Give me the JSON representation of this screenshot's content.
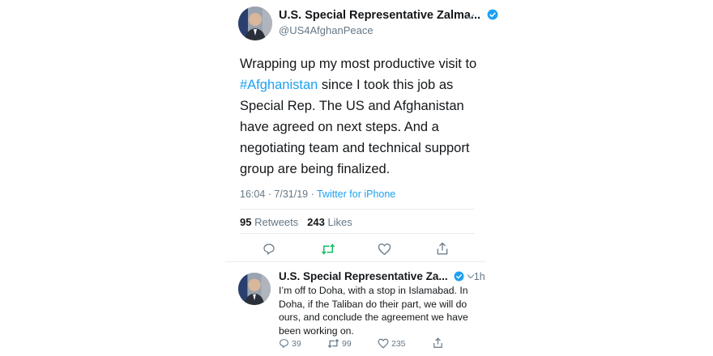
{
  "main_tweet": {
    "author_name": "U.S. Special Representative Zalma...",
    "handle": "@US4AfghanPeace",
    "text_before_hashtag": "Wrapping up my most productive visit to ",
    "hashtag": "#Afghanistan",
    "text_after_hashtag": " since I took this job as Special Rep. The US and Afghanistan have agreed on next steps. And a negotiating team and technical support group are being finalized.",
    "time": "16:04 · 7/31/19 · ",
    "source": "Twitter for iPhone",
    "retweet_count": "95",
    "retweet_label": " Retweets",
    "like_count": "243",
    "like_label": " Likes"
  },
  "reply_tweet": {
    "author_name": "U.S. Special Representative Za...",
    "time_ago": "· 1h",
    "text": "I’m off to Doha, with a stop in Islamabad. In Doha, if the Taliban do their part, we will do ours, and conclude the agreement we have been working on.",
    "reply_count": "39",
    "retweet_count": "99",
    "like_count": "235"
  },
  "icons": {
    "verified": "verified-badge-icon",
    "chevron": "chevron-down-icon",
    "reply": "reply-icon",
    "retweet": "retweet-icon",
    "like": "heart-icon",
    "share": "share-icon"
  },
  "colors": {
    "link": "#1da1f2",
    "retweet_active": "#17bf63",
    "muted": "#657786",
    "text": "#14171a"
  }
}
